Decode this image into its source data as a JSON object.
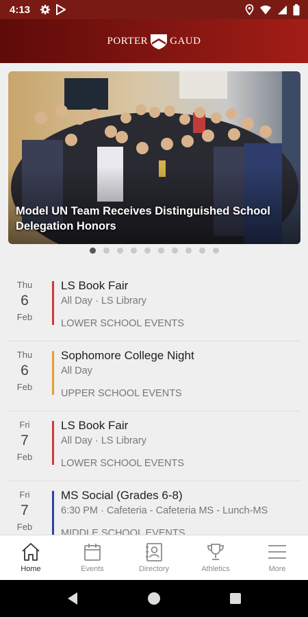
{
  "status_bar": {
    "time": "4:13"
  },
  "header": {
    "logo_left": "PORTER",
    "logo_right": "GAUD"
  },
  "carousel": {
    "caption": "Model UN Team Receives Distinguished School Delegation Honors",
    "slide_count": 10,
    "active_index": 0
  },
  "events": [
    {
      "dow": "Thu",
      "day": "6",
      "month": "Feb",
      "title": "LS Book Fair",
      "subtitle": "All Day · LS Library",
      "category": "LOWER SCHOOL EVENTS",
      "color": "#d1363a"
    },
    {
      "dow": "Thu",
      "day": "6",
      "month": "Feb",
      "title": "Sophomore College Night",
      "subtitle": "All Day",
      "category": "UPPER SCHOOL EVENTS",
      "color": "#e0a030"
    },
    {
      "dow": "Fri",
      "day": "7",
      "month": "Feb",
      "title": "LS Book Fair",
      "subtitle": "All Day · LS Library",
      "category": "LOWER SCHOOL EVENTS",
      "color": "#d1363a"
    },
    {
      "dow": "Fri",
      "day": "7",
      "month": "Feb",
      "title": "MS Social (Grades 6-8)",
      "subtitle": "6:30 PM · Cafeteria - Cafeteria MS - Lunch-MS",
      "category": "MIDDLE SCHOOL EVENTS",
      "color": "#2b3fa8"
    }
  ],
  "nav": {
    "home": "Home",
    "events": "Events",
    "directory": "Directory",
    "athletics": "Athletics",
    "more": "More"
  },
  "colors": {
    "brand": "#7c1410",
    "active_dot": "#555555",
    "inactive_dot": "#c9c9c9"
  }
}
